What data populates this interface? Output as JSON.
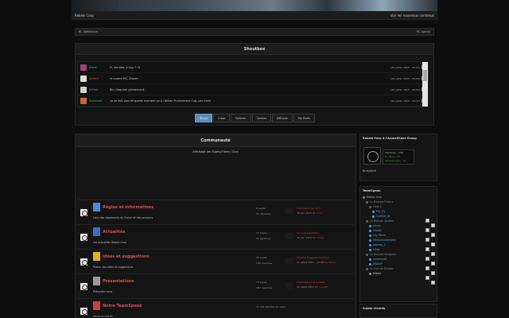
{
  "topbar": {
    "site_name": "Rebels Corp",
    "right_text": "Voir les nouveaux contenus"
  },
  "breadcrumb": {
    "left": "RC Webforum",
    "right": "RC Admin"
  },
  "shoutbox": {
    "title": "Shoutbox",
    "messages": [
      {
        "user": "Sione",
        "user_color": "#5aa0e0",
        "avatar_color": "#a0447a",
        "text": "Fr, sio dire, a hyg ? :D",
        "date": "(26 juillet, 2015 – 02:21)"
      },
      {
        "user": "Ambra",
        "user_color": "#d04040",
        "avatar_color": "#dddddd",
        "text": "re ouane MC, Xissen",
        "date": "(26 juillet, 2015 – 02:09)"
      },
      {
        "user": "DrOvil",
        "user_color": "#5aa0e0",
        "avatar_color": "#d0d0d0",
        "text": "Bio j'assume pleinement.",
        "date": "(26 juillet, 2015 – 02:08)"
      },
      {
        "user": "Swissadd",
        "user_color": "#4caa4c",
        "avatar_color": "#c56a22",
        "text": "ça se fait, pas de quelle moment ça à Utiliser Punishment Cup, par moin",
        "date": "(26 juillet, 2015 – 01:47)"
      }
    ],
    "buttons": [
      {
        "label": "Shout",
        "active": true
      },
      {
        "label": "Clear",
        "active": false
      },
      {
        "label": "Refresh",
        "active": false
      },
      {
        "label": "Smilies",
        "active": false
      },
      {
        "label": "BBCode",
        "active": false
      },
      {
        "label": "My Prefs",
        "active": false
      }
    ]
  },
  "community": {
    "title": "Communauté",
    "subnav": "Affichage par Sujets/Titres | Clics",
    "forums": [
      {
        "title": "Règles et informations",
        "desc": "Liste des règlements du Forum et des serveurs",
        "icon_color": "#4a8fd4",
        "topics": "6 sujets",
        "replies": "21 réponses",
        "last_title": "Information sur le Ti...",
        "last_date": "18 juin 2015",
        "last_by": "Par Kcas"
      },
      {
        "title": "Actualités",
        "desc": "Les actualités Rebels Corp",
        "icon_color": "#3a6fc4",
        "topics": "12 sujets",
        "replies": "81 réponses",
        "last_title": "Sur la présentation",
        "last_date": "22 juin 2015",
        "last_by": "Par Ardus"
      },
      {
        "title": "Idées et suggestions",
        "desc": "Poster vos idées et suggestions",
        "icon_color": "#e0b020",
        "topics": "29 sujets",
        "replies": "156 réponses",
        "last_title": "[Minkie] Suggestions/Idées",
        "last_date": "11 juillet 2015 – 14:46",
        "last_by": "Par Sione"
      },
      {
        "title": "Présentations",
        "desc": "Présentez vous",
        "icon_color": "#9a9a9a",
        "topics": "79 sujets",
        "replies": "397 réponses",
        "last_title": "Présentation de LeaWat",
        "last_date": "25 juillet 2015",
        "last_by": "Par LeaWat"
      },
      {
        "title": "Notre TeamSpeak",
        "desc": "Venez on est IR",
        "icon_color": "#d04040",
        "topics": "15 222 Nombre de vétre",
        "replies": "",
        "last_title": "",
        "last_date": "",
        "last_by": ""
      }
    ]
  },
  "profile": {
    "title": "Rebels Corp A l'AroneShaoc Group",
    "name": "Burlydore",
    "info": [
      {
        "text": "Membres : 338",
        "color": "#bbbbbb"
      },
      {
        "text": "En ligne : 13",
        "color": "#4caa4c"
      },
      {
        "text": "Derniers jour : 12",
        "color": "#4caa4c"
      }
    ]
  },
  "teamspeak": {
    "title": "TeamSpeak",
    "tree": [
      {
        "text": "Rebels Corp",
        "indent": 0,
        "color": "#aaaaaa",
        "dot": "#888888"
      },
      {
        "text": "Le Bivouac Publics",
        "indent": 1,
        "color": "#888888",
        "dot": "#666666"
      },
      {
        "text": "Salle 2",
        "indent": 2,
        "color": "#888888",
        "dot": "#666666"
      },
      {
        "text": "Pro_Ely",
        "indent": 3,
        "color": "#5aa0e0",
        "dot": "#5aa0e0"
      },
      {
        "text": "QueDir\\_nt",
        "indent": 3,
        "color": "#5aa0e0",
        "dot": "#5aa0e0"
      },
      {
        "text": "Le Bivouac Alsaber",
        "indent": 1,
        "color": "#888888",
        "dot": "#666666"
      },
      {
        "text": "Kricas",
        "indent": 2,
        "color": "#5aa0e0",
        "dot": "#5aa0e0"
      },
      {
        "text": "DeadK",
        "indent": 2,
        "color": "#5aa0e0",
        "dot": "#5aa0e0"
      },
      {
        "text": "Elly Patria",
        "indent": 2,
        "color": "#5aa0e0",
        "dot": "#5aa0e0"
      },
      {
        "text": "Maa\\Anjumeli\\Biel",
        "indent": 2,
        "color": "#5aa0e0",
        "dot": "#5aa0e0"
      },
      {
        "text": "session_2",
        "indent": 2,
        "color": "#5aa0e0",
        "dot": "#5aa0e0"
      },
      {
        "text": "Xissa",
        "indent": 2,
        "color": "#5aa0e0",
        "dot": "#5aa0e0"
      },
      {
        "text": "Le Bivouac Antigone",
        "indent": 1,
        "color": "#888888",
        "dot": "#666666"
      },
      {
        "text": "unidernedf",
        "indent": 2,
        "color": "#5aa0e0",
        "dot": "#5aa0e0"
      },
      {
        "text": "ReDiOP",
        "indent": 2,
        "color": "#5aa0e0",
        "dot": "#5aa0e0"
      },
      {
        "text": "Le Coin de Diadde",
        "indent": 1,
        "color": "#888888",
        "dot": "#666666"
      },
      {
        "text": "Diablo",
        "indent": 2,
        "color": "#cccccc",
        "dot": "#999999"
      }
    ]
  },
  "recent": {
    "title": "Sujets récents"
  }
}
